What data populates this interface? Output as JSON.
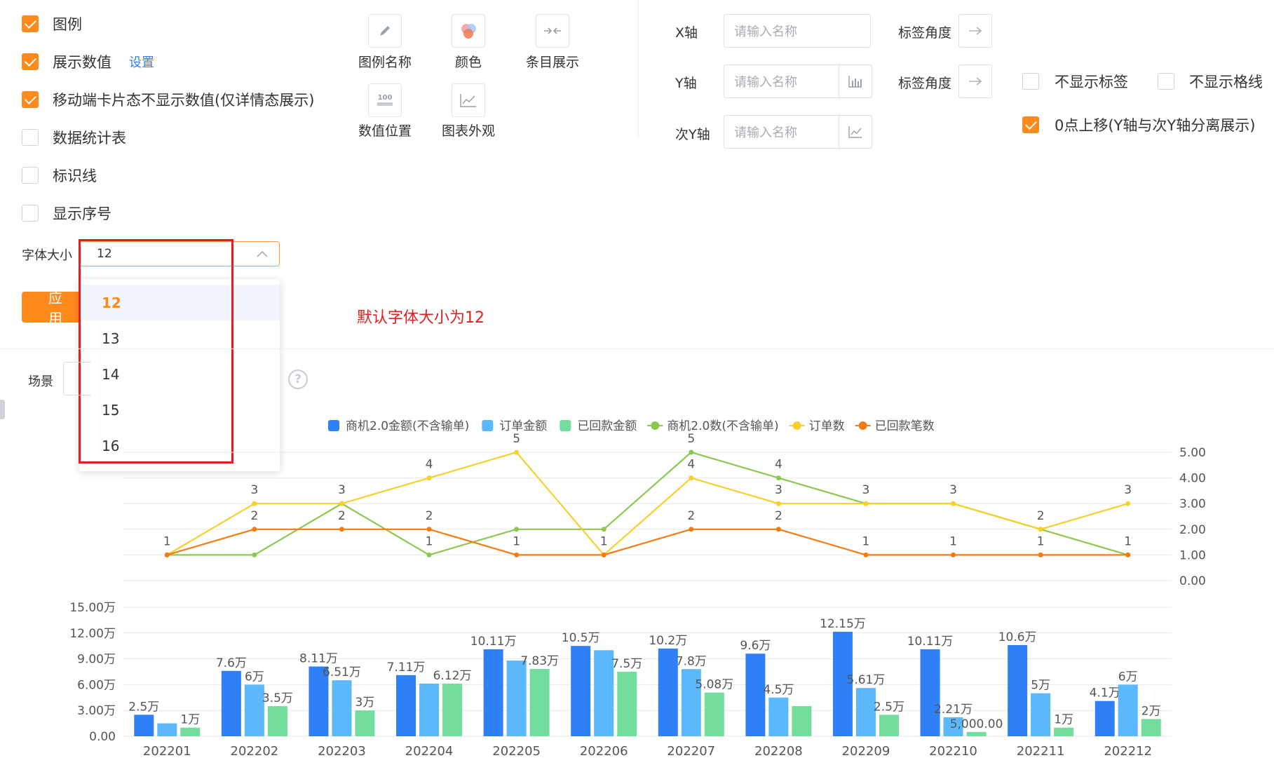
{
  "options": {
    "legend": {
      "label": "图例",
      "checked": true
    },
    "show_values": {
      "label": "展示数值",
      "checked": true,
      "settings_link": "设置"
    },
    "mobile_hide_values": {
      "label": "移动端卡片态不显示数值(仅详情态展示)",
      "checked": true
    },
    "data_table": {
      "label": "数据统计表",
      "checked": false
    },
    "marker_line": {
      "label": "标识线",
      "checked": false
    },
    "show_index": {
      "label": "显示序号",
      "checked": false
    }
  },
  "font_size": {
    "label": "字体大小",
    "value": "12",
    "options": [
      "12",
      "13",
      "14",
      "15",
      "16"
    ]
  },
  "apply_label": "应 用",
  "annotation": "默认字体大小为12",
  "tools": [
    {
      "label": "图例名称",
      "icon": "pencil-icon"
    },
    {
      "label": "颜色",
      "icon": "palette-icon"
    },
    {
      "label": "条目展示",
      "icon": "collapse-arrows-icon"
    },
    {
      "label": "数值位置",
      "icon": "value-position-icon",
      "icon_text": "100"
    },
    {
      "label": "图表外观",
      "icon": "line-chart-icon"
    }
  ],
  "axes": {
    "x": {
      "label": "X轴",
      "placeholder": "请输入名称",
      "angle_label": "标签角度"
    },
    "y": {
      "label": "Y轴",
      "placeholder": "请输入名称",
      "angle_label": "标签角度"
    },
    "y2": {
      "label": "次Y轴",
      "placeholder": "请输入名称"
    }
  },
  "axis_options": {
    "hide_labels": {
      "label": "不显示标签",
      "checked": false
    },
    "hide_grid": {
      "label": "不显示格线",
      "checked": false
    },
    "zero_shift": {
      "label": "0点上移(Y轴与次Y轴分离展示)",
      "checked": true
    }
  },
  "scene": {
    "label": "场景"
  },
  "colors": {
    "accent": "#ff8a1c",
    "link": "#2f7ef5",
    "annotation": "#e02020"
  },
  "chart_data": {
    "type": "bar",
    "categories": [
      "202201",
      "202202",
      "202203",
      "202204",
      "202205",
      "202206",
      "202207",
      "202208",
      "202209",
      "202210",
      "202211",
      "202212"
    ],
    "legend_position": "top",
    "y_ticks": [
      "0.00",
      "3.00万",
      "6.00万",
      "9.00万",
      "12.00万",
      "15.00万"
    ],
    "y_range": [
      0,
      150000
    ],
    "y2_ticks": [
      "0.00",
      "1.00",
      "2.00",
      "3.00",
      "4.00",
      "5.00"
    ],
    "y2_range": [
      0,
      5
    ],
    "bar_series": [
      {
        "name": "商机2.0金额(不含输单)",
        "color": "#2f80f7",
        "values": [
          25000,
          76000,
          81100,
          71100,
          101100,
          105000,
          102000,
          96000,
          121500,
          101100,
          106000,
          41000
        ],
        "labels": [
          "2.5万",
          "7.6万",
          "8.11万",
          "7.11万",
          "10.11万",
          "10.5万",
          "10.2万",
          "9.6万",
          "12.15万",
          "10.11万",
          "10.6万",
          "4.1万"
        ]
      },
      {
        "name": "订单金额",
        "color": "#5bb8fb",
        "values": [
          15000,
          60000,
          65100,
          61200,
          88000,
          100000,
          78000,
          45000,
          56100,
          22100,
          50000,
          60000
        ],
        "labels": [
          "",
          "6万",
          "6.51万",
          "",
          "",
          "",
          "7.8万",
          "4.5万",
          "5.61万",
          "2.21万",
          "5万",
          "6万"
        ]
      },
      {
        "name": "已回款金额",
        "color": "#72dd9c",
        "values": [
          10000,
          35000,
          30000,
          61200,
          78300,
          75000,
          50800,
          35000,
          25000,
          5000,
          10000,
          20000
        ],
        "labels": [
          "1万",
          "3.5万",
          "3万",
          "6.12万",
          "7.83万",
          "7.5万",
          "5.08万",
          "",
          "2.5万",
          "5,000.00",
          "1万",
          "2万"
        ]
      }
    ],
    "line_series": [
      {
        "name": "商机2.0数(不含输单)",
        "color": "#8cc850",
        "values": [
          1,
          1,
          3,
          1,
          2,
          2,
          5,
          4,
          3,
          3,
          2,
          1
        ],
        "labels": [
          "",
          "",
          "",
          "1",
          "",
          "",
          "5",
          "4",
          "",
          "",
          "",
          ""
        ]
      },
      {
        "name": "订单数",
        "color": "#f7d02c",
        "values": [
          1,
          3,
          3,
          4,
          5,
          1,
          4,
          3,
          3,
          3,
          2,
          3
        ],
        "labels": [
          "1",
          "3",
          "3",
          "4",
          "5",
          "",
          "4",
          "3",
          "3",
          "3",
          "2",
          "3"
        ]
      },
      {
        "name": "已回款笔数",
        "color": "#f57b11",
        "values": [
          1,
          2,
          2,
          2,
          1,
          1,
          2,
          2,
          1,
          1,
          1,
          1
        ],
        "labels": [
          "",
          "2",
          "2",
          "2",
          "1",
          "1",
          "2",
          "2",
          "1",
          "1",
          "1",
          "1"
        ]
      }
    ]
  }
}
